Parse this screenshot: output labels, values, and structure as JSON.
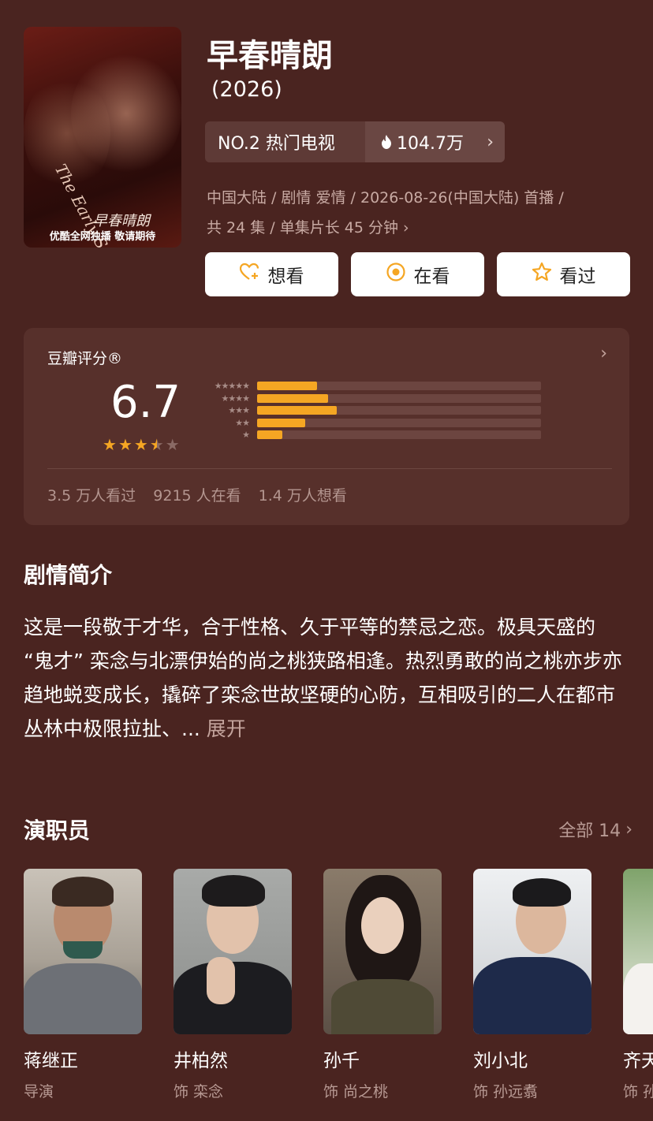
{
  "poster": {
    "en_title": "The Early Spring",
    "cn_title": "早春晴朗",
    "tagline": "优酷全网独播 敬请期待"
  },
  "title": "早春晴朗",
  "year": "(2026)",
  "rank": {
    "label": "NO.2 热门电视",
    "heat": "104.7万"
  },
  "meta": {
    "line1": "中国大陆 / 剧情 爱情 / 2026-08-26(中国大陆) 首播 /",
    "line2": "共 24 集 / 单集片长 45 分钟"
  },
  "actions": [
    {
      "label": "想看",
      "icon": "heart-plus-icon"
    },
    {
      "label": "在看",
      "icon": "target-icon"
    },
    {
      "label": "看过",
      "icon": "star-outline-icon"
    }
  ],
  "rating": {
    "label": "豆瓣评分®",
    "score": "6.7",
    "stars": 3.5,
    "distribution": [
      {
        "stars": "★★★★★",
        "fraction": 0.21
      },
      {
        "stars": "★★★★",
        "fraction": 0.25
      },
      {
        "stars": "★★★",
        "fraction": 0.28
      },
      {
        "stars": "★★",
        "fraction": 0.17
      },
      {
        "stars": "★",
        "fraction": 0.09
      }
    ],
    "stats": {
      "watched": "3.5 万人看过",
      "watching": "9215 人在看",
      "want": "1.4 万人想看"
    }
  },
  "synopsis": {
    "heading": "剧情简介",
    "text": "这是一段敬于才华，合于性格、久于平等的禁忌之恋。极具天盛的 “鬼才” 栾念与北漂伊始的尚之桃狭路相逢。热烈勇敢的尚之桃亦步亦趋地蜕变成长，撬碎了栾念世故坚硬的心防，互相吸引的二人在都市丛林中极限拉扯、... ",
    "more": "展开"
  },
  "cast": {
    "heading": "演职员",
    "all_label": "全部 14",
    "members": [
      {
        "name": "蒋继正",
        "role": "导演"
      },
      {
        "name": "井柏然",
        "role": "饰 栾念"
      },
      {
        "name": "孙千",
        "role": "饰 尚之桃"
      },
      {
        "name": "刘小北",
        "role": "饰 孙远翥"
      },
      {
        "name": "齐天",
        "role": "饰 孙"
      }
    ]
  },
  "colors": {
    "background": "#4a2420",
    "card": "#57302b",
    "accent_star": "#f5a623"
  }
}
